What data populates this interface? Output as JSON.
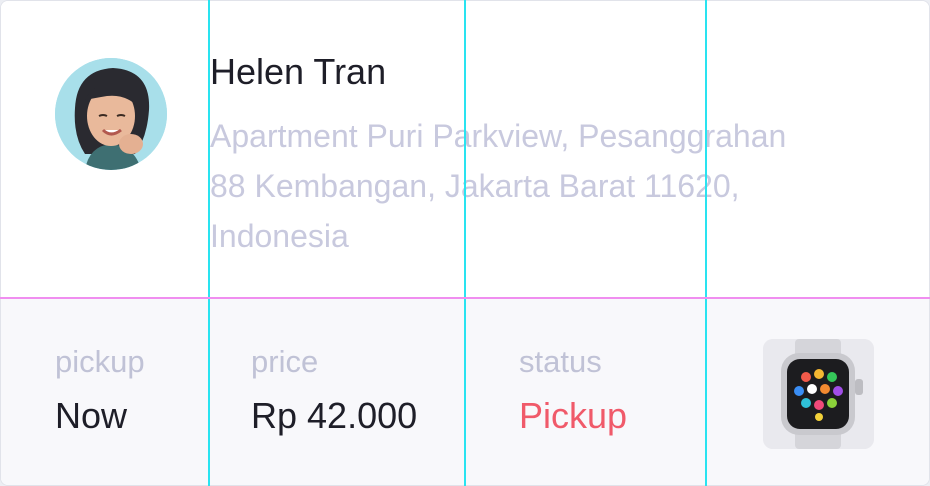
{
  "customer": {
    "name": "Helen Tran",
    "address_lines": [
      "Apartment Puri Parkview, Pesanggrahan",
      "88 Kembangan, Jakarta Barat 11620,",
      "Indonesia"
    ]
  },
  "details": {
    "pickup": {
      "label": "pickup",
      "value": "Now"
    },
    "price": {
      "label": "price",
      "value": "Rp 42.000"
    },
    "status": {
      "label": "status",
      "value": "Pickup",
      "color": "#f05a6a"
    }
  },
  "product": {
    "icon": "smartwatch-icon"
  },
  "colors": {
    "guide_vertical": "#29e3f0",
    "guide_horizontal": "#f08ef0",
    "label": "#c0c2d6",
    "address": "#c8c9de"
  }
}
